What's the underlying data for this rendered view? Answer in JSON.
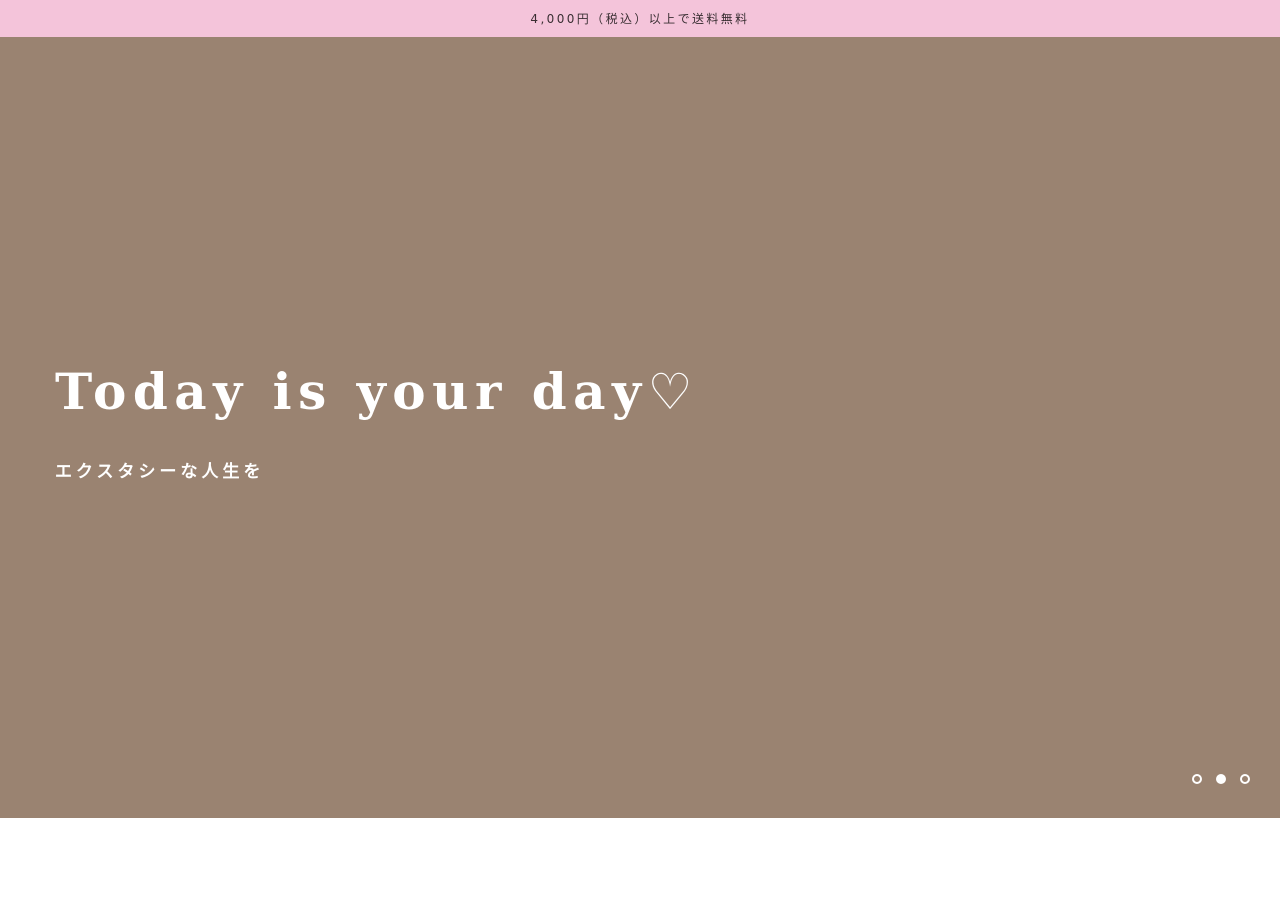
{
  "announcement": {
    "text": "4,000円（税込）以上で送料無料",
    "background": "#f4c4da"
  },
  "hero": {
    "background": "#9a8371",
    "title": "Today is your day♡",
    "subtitle": "エクスタシーな人生を",
    "slides": {
      "count": 3,
      "active_index": 1
    }
  }
}
